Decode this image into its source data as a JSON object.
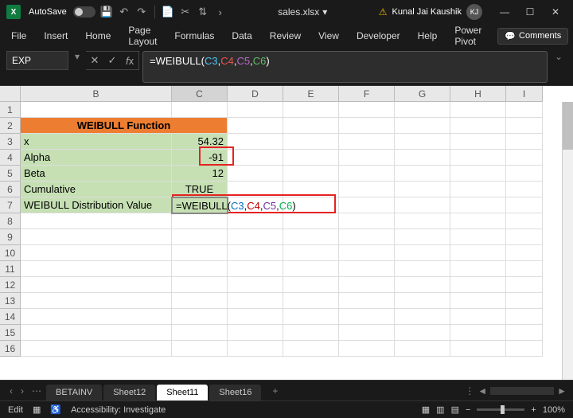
{
  "title": {
    "autosave": "AutoSave",
    "filename": "sales.xlsx",
    "user": "Kunal Jai Kaushik",
    "initials": "KJ"
  },
  "ribbon": {
    "tabs": [
      "File",
      "Insert",
      "Home",
      "Page Layout",
      "Formulas",
      "Data",
      "Review",
      "View",
      "Developer",
      "Help",
      "Power Pivot"
    ],
    "comments": "Comments"
  },
  "namebox": "EXP",
  "formula": {
    "prefix": "=WEIBULL(",
    "a1": "C3",
    "a2": "C4",
    "a3": "C5",
    "a4": "C6",
    "suffix": ")"
  },
  "columns": [
    "B",
    "C",
    "D",
    "E",
    "F",
    "G",
    "H",
    "I"
  ],
  "rows": [
    "1",
    "2",
    "3",
    "4",
    "5",
    "6",
    "7",
    "8",
    "9",
    "10",
    "11",
    "12",
    "13",
    "14",
    "15",
    "16"
  ],
  "cells": {
    "b2": "WEIBULL Function",
    "b3": "x",
    "c3": "54.32",
    "b4": "Alpha",
    "c4": "-91",
    "b5": "Beta",
    "c5": "12",
    "b6": "Cumulative",
    "c6": "TRUE",
    "b7": "WEIBULL Distribution Value",
    "c7": {
      "prefix": "=WEIBULL(",
      "a1": "C3",
      "a2": "C4",
      "a3": "C5",
      "a4": "C6",
      "suffix": ")"
    }
  },
  "sheets": {
    "list": [
      "BETAINV",
      "Sheet12",
      "Sheet11",
      "Sheet16"
    ],
    "active": "Sheet11"
  },
  "status": {
    "mode": "Edit",
    "access": "Accessibility: Investigate",
    "zoom": "100%"
  },
  "chart_data": null
}
